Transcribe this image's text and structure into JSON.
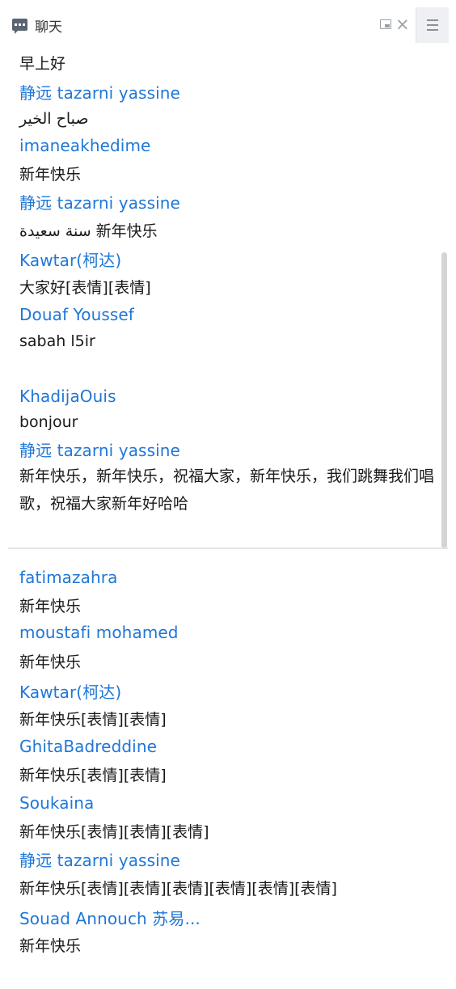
{
  "header": {
    "title": "聊天",
    "close_symbol": "×",
    "icons": [
      "chat-icon",
      "popout-icon",
      "close-icon",
      "menu-icon"
    ]
  },
  "top_messages": [
    {
      "kind": "text",
      "value": "早上好"
    },
    {
      "kind": "name",
      "value": "静远 tazarni yassine"
    },
    {
      "kind": "text",
      "value": "صباح الخير"
    },
    {
      "kind": "name",
      "value": "imaneakhedime"
    },
    {
      "kind": "text",
      "value": "新年快乐"
    },
    {
      "kind": "name",
      "value": "静远 tazarni yassine"
    },
    {
      "kind": "text",
      "value": "سنة سعيدة 新年快乐"
    },
    {
      "kind": "name",
      "value": "Kawtar(柯达)"
    },
    {
      "kind": "text",
      "value": "大家好[表情][表情]"
    },
    {
      "kind": "name",
      "value": " Douaf Youssef"
    },
    {
      "kind": "text",
      "value": "sabah l5ir"
    },
    {
      "kind": "name",
      "value": "KhadijaOuis"
    },
    {
      "kind": "text",
      "value": "bonjour"
    },
    {
      "kind": "name",
      "value": "静远 tazarni yassine"
    },
    {
      "kind": "text",
      "value": "新年快乐，新年快乐，祝福大家，新年快乐，我们跳舞我们唱歌，祝福大家新年好哈哈"
    }
  ],
  "bottom_messages": [
    {
      "kind": "name",
      "value": "fatimazahra"
    },
    {
      "kind": "text",
      "value": "新年快乐"
    },
    {
      "kind": "name",
      "value": "moustafi mohamed"
    },
    {
      "kind": "text",
      "value": " 新年快乐"
    },
    {
      "kind": "name",
      "value": "Kawtar(柯达)"
    },
    {
      "kind": "text",
      "value": "新年快乐[表情][表情]"
    },
    {
      "kind": "name",
      "value": "GhitaBadreddine"
    },
    {
      "kind": "text",
      "value": "新年快乐[表情][表情]"
    },
    {
      "kind": "name",
      "value": "Soukaina"
    },
    {
      "kind": "text",
      "value": "新年快乐[表情][表情][表情]"
    },
    {
      "kind": "name",
      "value": "静远 tazarni yassine"
    },
    {
      "kind": "text",
      "value": "新年快乐[表情][表情][表情][表情][表情][表情]"
    },
    {
      "kind": "name",
      "value": "Souad Annouch 苏易..."
    },
    {
      "kind": "text",
      "value": "新年快乐"
    }
  ],
  "colors": {
    "name": "#1f77d8",
    "text": "#1a1a1a",
    "divider": "#e4e4e4"
  }
}
